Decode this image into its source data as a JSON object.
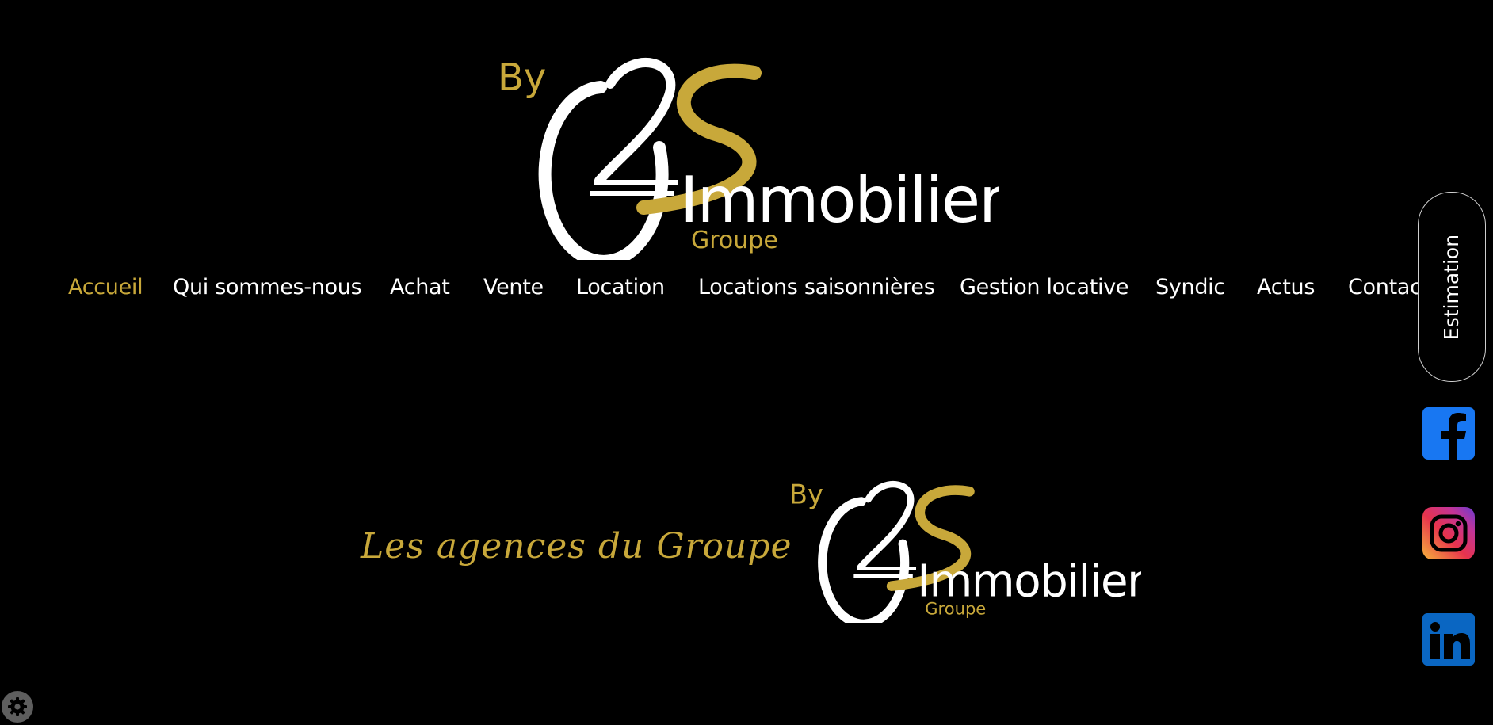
{
  "theme": {
    "accent": "#c8a83a",
    "background": "#000000",
    "text": "#ffffff"
  },
  "logo": {
    "by": "By",
    "name": "Immobilier",
    "group": "Groupe"
  },
  "nav": {
    "items": [
      {
        "label": "Accueil",
        "active": true
      },
      {
        "label": "Qui sommes-nous"
      },
      {
        "label": "Achat"
      },
      {
        "label": "Vente"
      },
      {
        "label": "Location"
      },
      {
        "label": "Locations saisonnières"
      },
      {
        "label": "Gestion locative"
      },
      {
        "label": "Syndic"
      },
      {
        "label": "Actus"
      },
      {
        "label": "Contact"
      }
    ]
  },
  "estimation": {
    "label": "Estimation"
  },
  "social": {
    "icons": [
      "facebook-icon",
      "instagram-icon",
      "linkedin-icon"
    ]
  },
  "hero": {
    "title": "Les agences du Groupe"
  },
  "cookie": {
    "icon": "gear-icon"
  }
}
